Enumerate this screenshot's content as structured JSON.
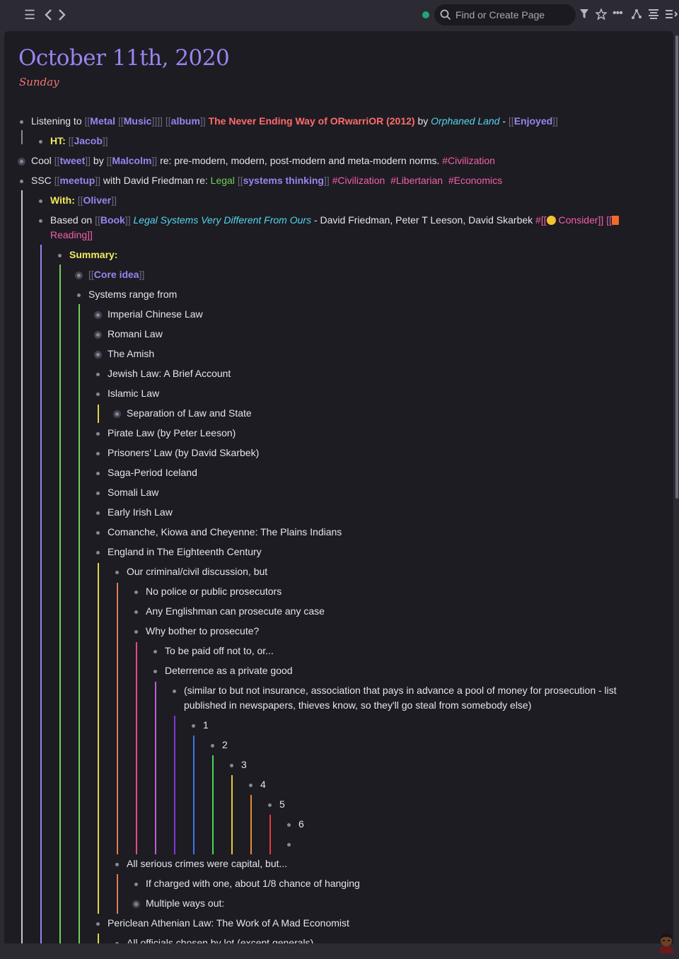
{
  "topbar": {
    "menu_icon": "menu-icon",
    "back_icon": "chevron-left-icon",
    "forward_icon": "chevron-right-icon",
    "search_placeholder": "Find or Create Page",
    "actions": [
      "filter-icon",
      "star-icon",
      "more-icon",
      "graph-icon",
      "align-icon",
      "sidebar-icon"
    ]
  },
  "page": {
    "title": "October 11th, 2020",
    "subtitle": "Sunday"
  },
  "blocks": {
    "b1": {
      "t1": "Listening to ",
      "r1": "Metal ",
      "r2": "Music",
      "r3": "album",
      "t2": "The Never Ending Way of ORwarriOR (2012)",
      "t3": " by ",
      "t4": "Orphaned Land",
      "t5": " - ",
      "r4": "Enjoyed"
    },
    "b2": {
      "label": "HT:",
      "r1": "Jacob"
    },
    "b3": {
      "t1": "Cool ",
      "r1": "tweet",
      "t2": " by ",
      "r2": "Malcolm",
      "t3": " re: pre-modern, modern, post-modern and meta-modern norms. ",
      "tag1": "#Civilization"
    },
    "b4": {
      "t1": "SSC ",
      "r1": "meetup",
      "t2": " with David Friedman re: ",
      "t3": "Legal",
      "r2": "systems thinking",
      "tag1": "#Civilization",
      "tag2": "#Libertarian",
      "tag3": "#Economics"
    },
    "b5": {
      "label": "With:",
      "r1": "Oliver"
    },
    "b6": {
      "t1": "Based on ",
      "r1": "Book",
      "t2": "Legal Systems Very Different From Ours",
      "t3": " - David Friedman, Peter T Leeson, David Skarbek ",
      "tag1": "Consider",
      "tag2": "Reading"
    },
    "b7": {
      "label": "Summary:"
    },
    "b8": {
      "r1": "Core idea"
    },
    "b9": "Systems range from",
    "b10": "Imperial Chinese Law",
    "b11": "Romani Law",
    "b12": "The Amish",
    "b13": "Jewish Law: A Brief Account",
    "b14": "Islamic Law",
    "b15": "Separation of Law and State",
    "b16": "Pirate Law (by Peter Leeson)",
    "b17": "Prisoners’ Law (by David Skarbek)",
    "b18": "Saga-Period Iceland",
    "b19": "Somali Law",
    "b20": "Early Irish Law",
    "b21": "Comanche, Kiowa and Cheyenne: The Plains Indians",
    "b22": "England in The Eighteenth Century",
    "b23": "Our criminal/civil discussion, but",
    "b24": "No police or public prosecutors",
    "b25": "Any Englishman can prosecute any case",
    "b26": "Why bother to prosecute?",
    "b27": "To be paid off not to, or...",
    "b28": "Deterrence as a private good",
    "b29": "(similar to but not insurance, association that pays in advance a pool of money for prosecution - list published in newspapers, thieves know, so they'll go steal from somebody else)",
    "b30": "1",
    "b31": "2",
    "b32": "3",
    "b33": "4",
    "b34": "5",
    "b35": "6",
    "b36": "",
    "b37": "All serious crimes were capital, but...",
    "b38": "If charged with one, about 1/8 chance of hanging",
    "b39": "Multiple ways out:",
    "b40": "Periclean Athenian Law: The Work of A Mad Economist",
    "b41": "All officials chosen by lot (except generals)"
  },
  "colors": {
    "accent": "#9b84f0",
    "tag": "#f45eaa",
    "highlight": "#ff6b6b"
  }
}
